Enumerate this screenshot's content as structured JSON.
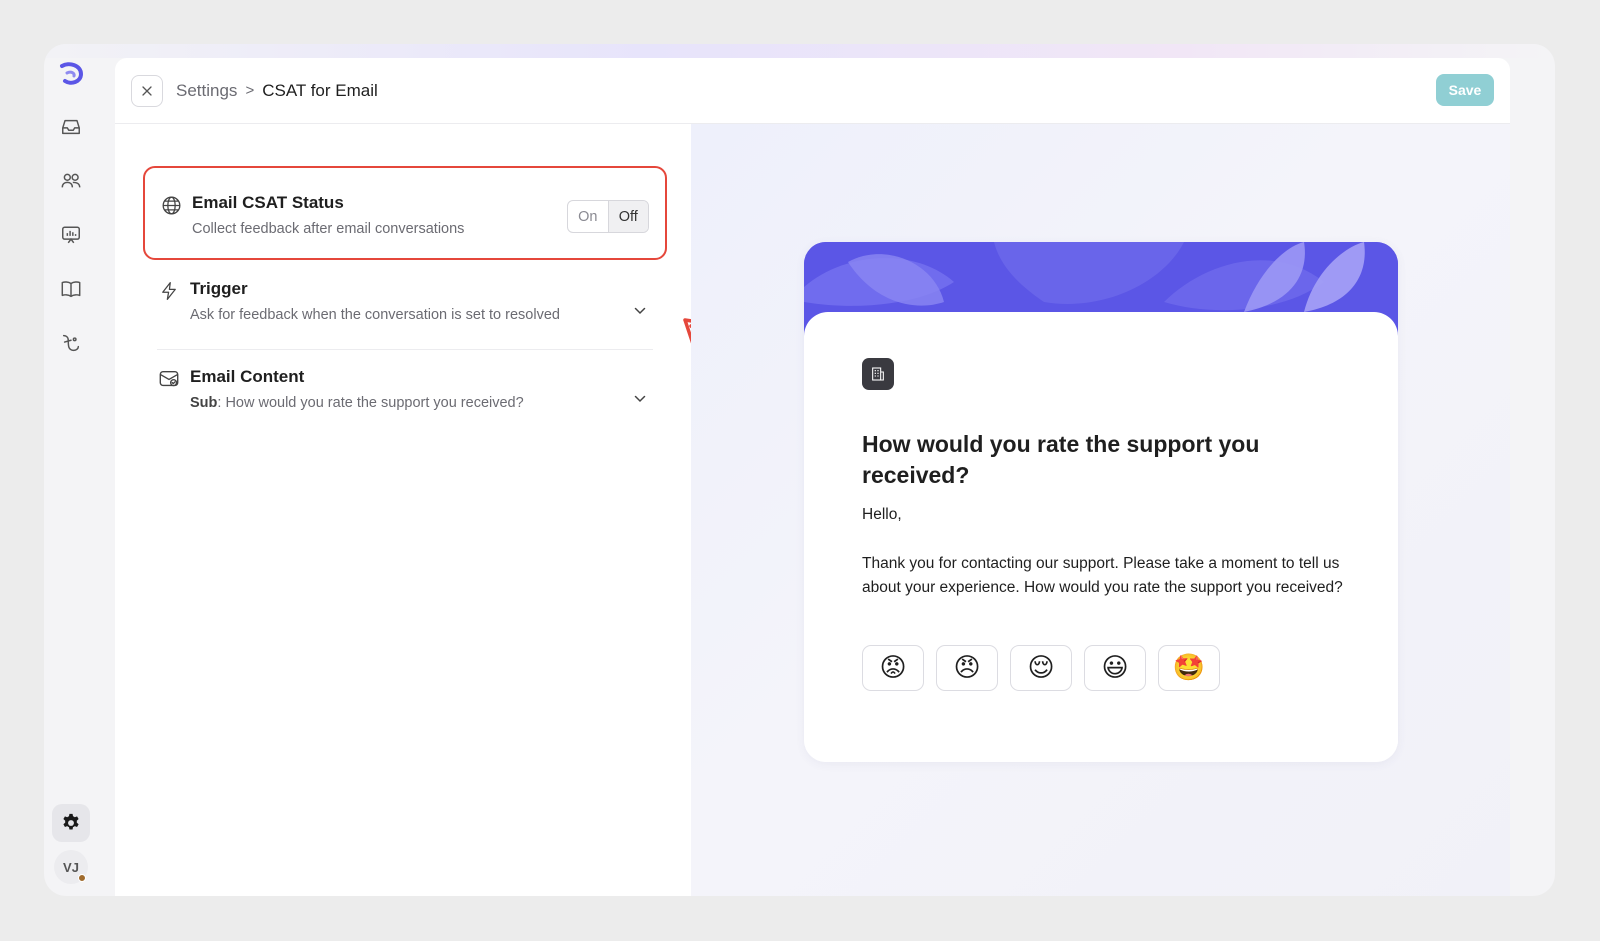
{
  "header": {
    "breadcrumb_parent": "Settings",
    "breadcrumb_separator": ">",
    "breadcrumb_current": "CSAT for Email",
    "save_label": "Save"
  },
  "sidebar": {
    "items": [
      {
        "icon": "inbox-icon"
      },
      {
        "icon": "users-icon"
      },
      {
        "icon": "reports-icon"
      },
      {
        "icon": "knowledge-base-icon"
      },
      {
        "icon": "automation-icon"
      }
    ],
    "avatar_initials": "VJ"
  },
  "settings": {
    "status": {
      "title": "Email CSAT Status",
      "description": "Collect feedback after email conversations",
      "toggle_on": "On",
      "toggle_off": "Off",
      "selected": "Off"
    },
    "trigger": {
      "title": "Trigger",
      "description": "Ask for feedback when the conversation is set to resolved"
    },
    "content": {
      "title": "Email Content",
      "sub_label": "Sub",
      "sub_text": ": How would you rate the support you received?"
    }
  },
  "preview": {
    "heading": "How would you rate the support you received?",
    "greeting": "Hello,",
    "message": "Thank you for contacting our support. Please take a moment to tell us about your experience. How would you rate the support you received?",
    "ratings": [
      "😡",
      "😠",
      "😌",
      "😃",
      "🤩"
    ]
  },
  "colors": {
    "accent": "#5b56e6",
    "highlight": "#e5473b",
    "save_button": "#90cfd4"
  }
}
